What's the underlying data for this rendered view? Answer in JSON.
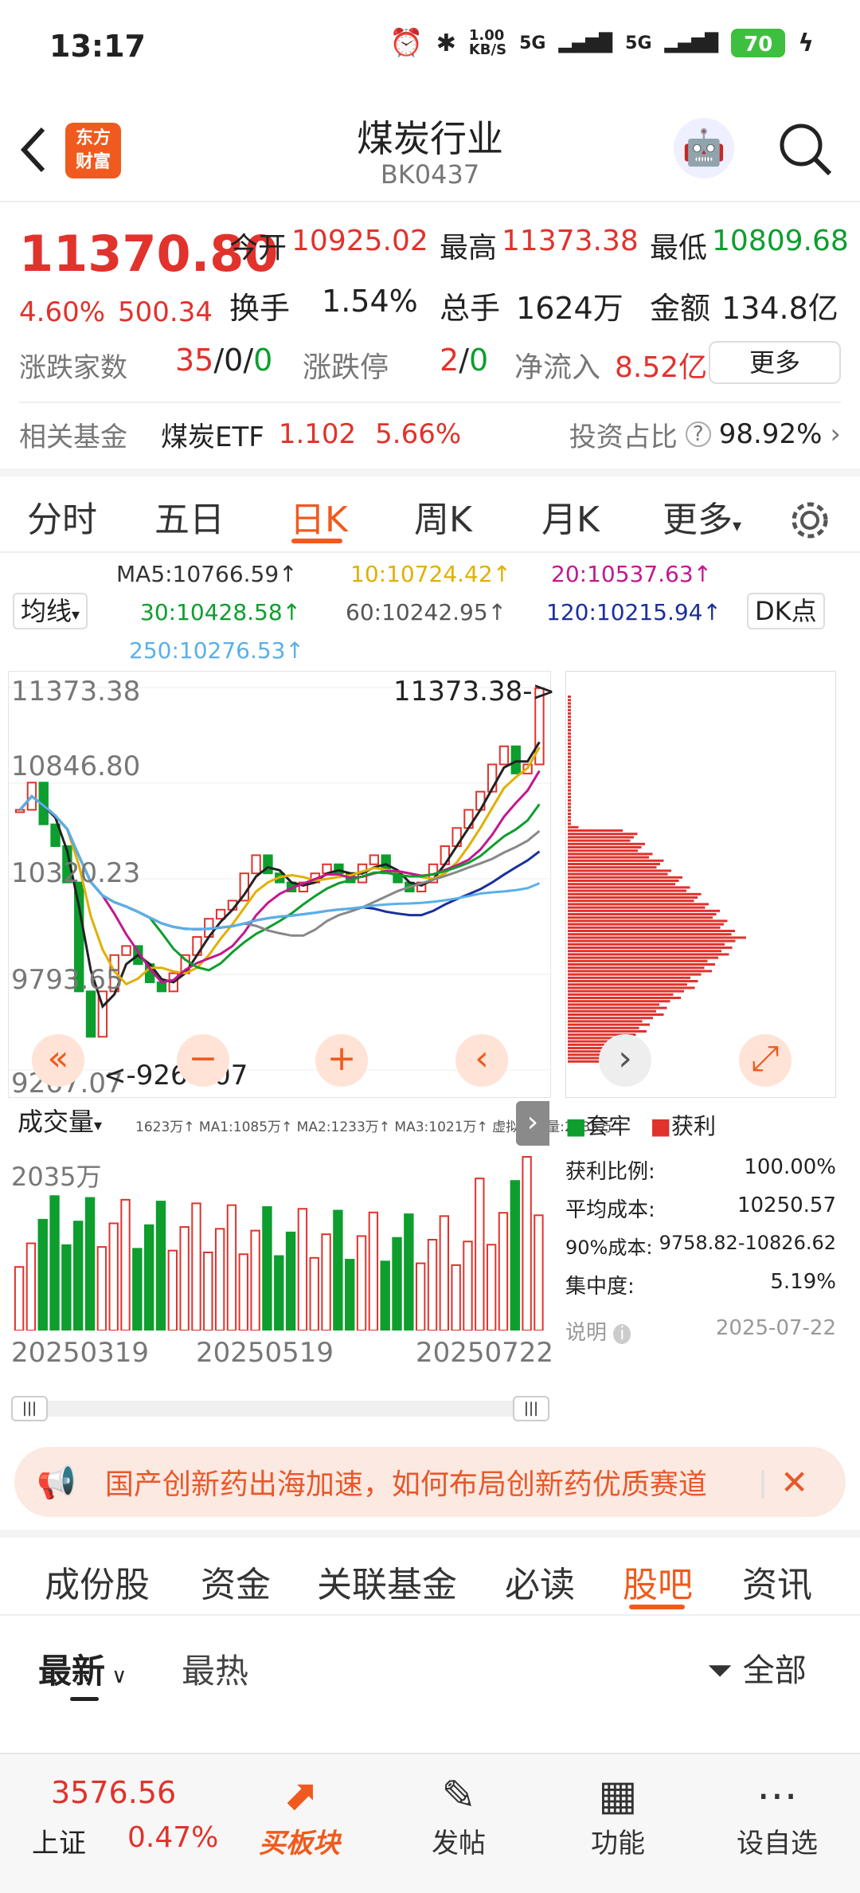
{
  "status": {
    "time": "13:17",
    "net_speed": "1.00\nKB/S",
    "signal1": "5G",
    "signal2": "5G",
    "battery": "70"
  },
  "header": {
    "back_icon": "chevron-left-icon",
    "logo": "东方\n财富",
    "title": "煤炭行业",
    "code": "BK0437"
  },
  "quote": {
    "price": "11370.80",
    "change_pct": "4.60%",
    "change_abs": "500.34",
    "open_label": "今开",
    "open": "10925.02",
    "high_label": "最高",
    "high": "11373.38",
    "low_label": "最低",
    "low": "10809.68",
    "turnover_label": "换手",
    "turnover": "1.54%",
    "volume_label": "总手",
    "volume": "1624万",
    "amount_label": "金额",
    "amount": "134.8亿",
    "breadth_label": "涨跌家数",
    "up": "35",
    "flat": "0",
    "down": "0",
    "limit_label": "涨跌停",
    "limit_up": "2",
    "limit_down": "0",
    "netflow_label": "净流入",
    "netflow": "8.52亿",
    "more_label": "更多"
  },
  "fund": {
    "label": "相关基金",
    "name": "煤炭ETF",
    "price": "1.102",
    "pct": "5.66%",
    "ratio_label": "投资占比",
    "ratio": "98.92%"
  },
  "chart_tabs": [
    "分时",
    "五日",
    "日K",
    "周K",
    "月K",
    "更多"
  ],
  "active_chart_tab": "日K",
  "ma_line": {
    "selector": "均线",
    "ma5": "MA5:10766.59↑",
    "ma10": "10:10724.42↑",
    "ma20": "20:10537.63↑",
    "ma30": "30:10428.58↑",
    "ma60": "60:10242.95↑",
    "ma120": "120:10215.94↑",
    "ma250": "250:10276.53↑",
    "dk": "DK点"
  },
  "kline": {
    "top": "11373.38",
    "l2": "10846.80",
    "l3": "10320.23",
    "l4": "9793.65",
    "bottom": "9267.07",
    "high_marker": "11373.38->",
    "low_marker": "<-9267.07"
  },
  "volume": {
    "selector": "成交量",
    "legend": "1623万↑ MA1:1085万↑ MA2:1233万↑ MA3:1021万↑ 虚拟成交量:2035万",
    "max": "2035万"
  },
  "dates": [
    "20250319",
    "20250519",
    "20250722"
  ],
  "chip": {
    "legend_trap": "套牢",
    "legend_profit": "获利",
    "profit_ratio_label": "获利比例:",
    "profit_ratio": "100.00%",
    "avg_cost_label": "平均成本:",
    "avg_cost": "10250.57",
    "cost90_label": "90%成本:",
    "cost90": "9758.82-10826.62",
    "conc_label": "集中度:",
    "conc": "5.19%",
    "note_label": "说明",
    "date": "2025-07-22"
  },
  "banner": {
    "text": "国产创新药出海加速，如何布局创新药优质赛道"
  },
  "section_tabs": [
    "成份股",
    "资金",
    "关联基金",
    "必读",
    "股吧",
    "资讯"
  ],
  "active_section": "股吧",
  "sort": {
    "latest": "最新",
    "hot": "最热",
    "filter": "全部"
  },
  "bottom": {
    "index_price": "3576.56",
    "index_name": "上证",
    "index_pct": "0.47%",
    "b1": "买板块",
    "b2": "发帖",
    "b3": "功能",
    "b4": "设自选"
  },
  "colors": {
    "up": "#e1322c",
    "down": "#0d9e2e",
    "accent": "#f05a1e"
  },
  "chart_data": {
    "type": "candlestick",
    "title": "",
    "y_ticks": [
      "11373.38",
      "10846.80",
      "10320.23",
      "9793.65",
      "9267.07"
    ],
    "x_ticks": [
      "20250319",
      "20250519",
      "20250722"
    ],
    "close_series": [
      10700,
      10850,
      10620,
      10500,
      10300,
      9700,
      9450,
      9700,
      9900,
      9950,
      9850,
      9750,
      9700,
      9800,
      9900,
      10000,
      10100,
      10150,
      10200,
      10350,
      10450,
      10350,
      10300,
      10250,
      10300,
      10350,
      10400,
      10350,
      10300,
      10400,
      10450,
      10350,
      10300,
      10250,
      10300,
      10400,
      10500,
      10600,
      10700,
      10800,
      10950,
      11050,
      10900,
      10950,
      11370
    ]
  }
}
